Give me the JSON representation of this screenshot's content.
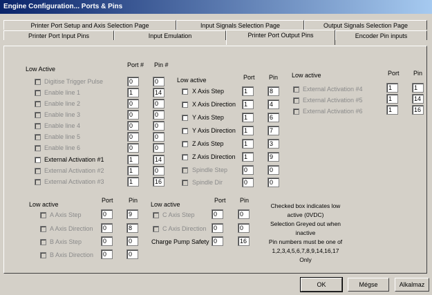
{
  "title": "Engine Configuration... Ports & Pins",
  "tabs_row1": [
    "Printer Port Setup and Axis Selection Page",
    "Input Signals Selection Page",
    "Output Signals Selection Page"
  ],
  "tabs_row2": [
    "Printer Port Input Pins",
    "Input Emulation",
    "Printer Port Output Pins",
    "Encoder Pin inputs"
  ],
  "active_tab": "Printer Port Output Pins",
  "group1": {
    "title": "Low Active",
    "port_header": "Port #",
    "pin_header": "Pin #",
    "rows": [
      {
        "label": "Digitise Trigger Pulse",
        "port": "0",
        "pin": "0"
      },
      {
        "label": "Enable line 1",
        "port": "1",
        "pin": "14"
      },
      {
        "label": "Enable line 2",
        "port": "0",
        "pin": "0"
      },
      {
        "label": "Enable line 3",
        "port": "0",
        "pin": "0"
      },
      {
        "label": "Enable line 4",
        "port": "0",
        "pin": "0"
      },
      {
        "label": "Enable line 5",
        "port": "0",
        "pin": "0"
      },
      {
        "label": "Enable line 6",
        "port": "0",
        "pin": "0"
      },
      {
        "label": "External Activation #1",
        "port": "1",
        "pin": "14"
      },
      {
        "label": "External Activation #2",
        "port": "1",
        "pin": "0"
      },
      {
        "label": "External Activation #3",
        "port": "1",
        "pin": "16"
      }
    ]
  },
  "group2": {
    "title": "Low active",
    "port_header": "Port",
    "pin_header": "Pin",
    "rows": [
      {
        "label": "X Axis Step",
        "port": "1",
        "pin": "8"
      },
      {
        "label": "X Axis Direction",
        "port": "1",
        "pin": "4"
      },
      {
        "label": "Y Axis Step",
        "port": "1",
        "pin": "6"
      },
      {
        "label": "Y Axis Direction",
        "port": "1",
        "pin": "7"
      },
      {
        "label": "Z Axis Step",
        "port": "1",
        "pin": "3"
      },
      {
        "label": "Z Axis Direction",
        "port": "1",
        "pin": "9"
      },
      {
        "label": "Spindle Step",
        "port": "0",
        "pin": "0"
      },
      {
        "label": "Spindle Dir",
        "port": "0",
        "pin": "0"
      }
    ]
  },
  "group3": {
    "title": "Low active",
    "port_header": "Port",
    "pin_header": "Pin",
    "rows": [
      {
        "label": "External Activation #4",
        "port": "1",
        "pin": "1"
      },
      {
        "label": "External Activation #5",
        "port": "1",
        "pin": "14"
      },
      {
        "label": "External Activation #6",
        "port": "1",
        "pin": "16"
      }
    ]
  },
  "group4": {
    "title": "Low active",
    "port_header": "Port",
    "pin_header": "Pin",
    "rows": [
      {
        "label": "A Axis Step",
        "port": "0",
        "pin": "9"
      },
      {
        "label": "A Axis Direction",
        "port": "0",
        "pin": "8"
      },
      {
        "label": "B Axis Step",
        "port": "0",
        "pin": "0"
      },
      {
        "label": "B Axis Direction",
        "port": "0",
        "pin": "0"
      }
    ]
  },
  "group5": {
    "title": "Low active",
    "port_header": "Port",
    "pin_header": "Pin",
    "rows": [
      {
        "label": "C Axis Step",
        "port": "0",
        "pin": "0"
      },
      {
        "label": "C Axis Direction",
        "port": "0",
        "pin": "0"
      }
    ],
    "charge_pump": {
      "label": "Charge Pump Safety",
      "port": "0",
      "pin": "16"
    }
  },
  "note": {
    "line1": "Checked box indicates low",
    "line2": "active (0VDC)",
    "line3": "Selection Greyed out when",
    "line4": "inactive",
    "line5": "Pin numbers must be one of",
    "line6": "1,2,3,4,5,6,7,8,9,14,16,17",
    "line7": "Only"
  },
  "buttons": {
    "ok": "OK",
    "cancel": "Mégse",
    "apply": "Alkalmaz"
  }
}
